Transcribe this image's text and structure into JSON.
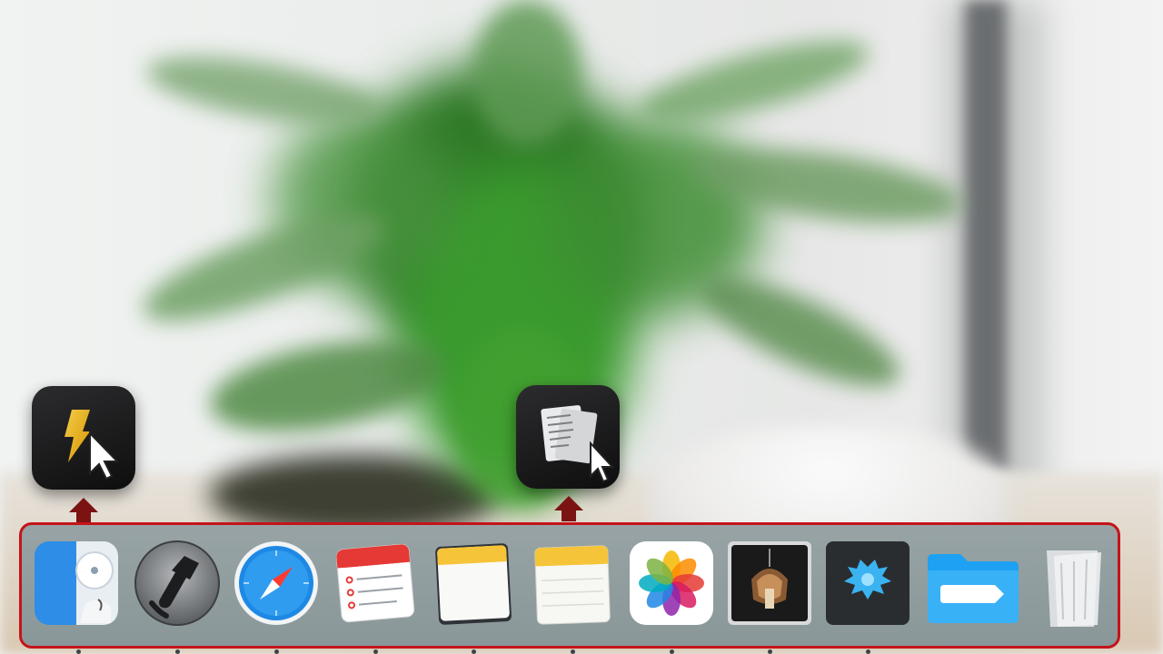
{
  "dock": {
    "items": [
      {
        "name": "finder",
        "icon": "finder-icon"
      },
      {
        "name": "system-tool",
        "icon": "wrench-icon"
      },
      {
        "name": "safari",
        "icon": "compass-icon"
      },
      {
        "name": "reminders",
        "icon": "reminders-icon"
      },
      {
        "name": "notes",
        "icon": "notes-icon"
      },
      {
        "name": "notes-2",
        "icon": "notes-icon"
      },
      {
        "name": "photos",
        "icon": "photos-icon"
      },
      {
        "name": "artwork-app",
        "icon": "artwork-icon"
      },
      {
        "name": "blue-ornament-app",
        "icon": "ornament-icon"
      },
      {
        "name": "folder",
        "icon": "folder-icon"
      },
      {
        "name": "trash",
        "icon": "trash-icon"
      }
    ],
    "highlight_color": "#c4141a"
  },
  "dragged_icons": [
    {
      "name": "shortcut-app",
      "icon": "lightning-icon",
      "accent": "#f5b800"
    },
    {
      "name": "documents-app",
      "icon": "documents-icon"
    }
  ],
  "colors": {
    "arrow": "#7b1313",
    "dock_border": "#c4141a"
  }
}
